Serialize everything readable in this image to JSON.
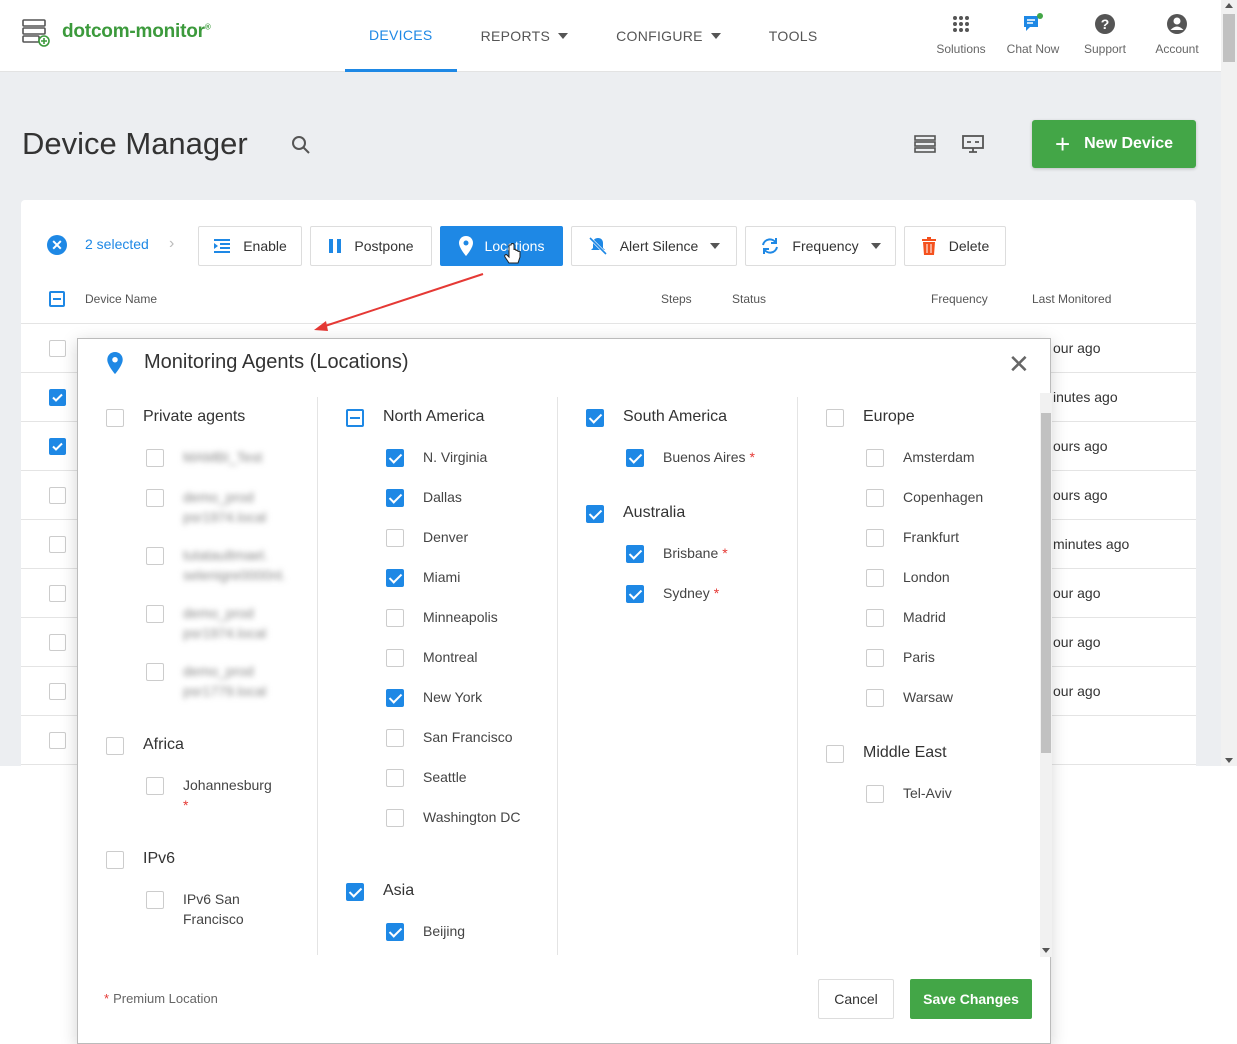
{
  "brand": {
    "name": "dotcom-monitor",
    "reg": "®"
  },
  "nav": {
    "items": [
      {
        "label": "DEVICES",
        "active": true
      },
      {
        "label": "REPORTS",
        "dropdown": true
      },
      {
        "label": "CONFIGURE",
        "dropdown": true
      },
      {
        "label": "TOOLS"
      }
    ]
  },
  "top_right": [
    {
      "label": "Solutions",
      "icon": "grid-icon"
    },
    {
      "label": "Chat Now",
      "icon": "chat-icon"
    },
    {
      "label": "Support",
      "icon": "help-icon"
    },
    {
      "label": "Account",
      "icon": "account-icon"
    }
  ],
  "page": {
    "title": "Device Manager",
    "new_device": "New Device"
  },
  "toolbar": {
    "selected": "2 selected",
    "enable": "Enable",
    "postpone": "Postpone",
    "locations": "Locations",
    "alert_silence": "Alert Silence",
    "frequency": "Frequency",
    "delete": "Delete"
  },
  "table": {
    "headers": {
      "name": "Device Name",
      "steps": "Steps",
      "status": "Status",
      "frequency": "Frequency",
      "last": "Last Monitored"
    },
    "rows": [
      {
        "checked": false,
        "last": "our ago"
      },
      {
        "checked": true,
        "last": "inutes ago"
      },
      {
        "checked": true,
        "last": "ours ago"
      },
      {
        "checked": false,
        "last": "ours ago"
      },
      {
        "checked": false,
        "last": "minutes ago"
      },
      {
        "checked": false,
        "last": "our ago"
      },
      {
        "checked": false,
        "last": "our ago"
      },
      {
        "checked": false,
        "last": "our ago"
      },
      {
        "checked": false,
        "last": ""
      }
    ]
  },
  "dialog": {
    "title": "Monitoring Agents (Locations)",
    "premium_note": "Premium Location",
    "cancel": "Cancel",
    "save": "Save Changes",
    "groups": {
      "private": {
        "label": "Private agents",
        "items": [
          "MAMBI_Test",
          "demo_prod psr1974.local",
          "tutatau8mael. selenigre0000nl.",
          "demo_prod psr1974.local",
          "demo_prod psr1779.local"
        ]
      },
      "africa": {
        "label": "Africa",
        "items": [
          "Johannesburg"
        ]
      },
      "ipv6": {
        "label": "IPv6",
        "items": [
          "IPv6 San Francisco"
        ]
      },
      "north_america": {
        "label": "North America",
        "items": [
          "N. Virginia",
          "Dallas",
          "Denver",
          "Miami",
          "Minneapolis",
          "Montreal",
          "New York",
          "San Francisco",
          "Seattle",
          "Washington DC"
        ]
      },
      "asia": {
        "label": "Asia",
        "items": [
          "Beijing"
        ]
      },
      "south_america": {
        "label": "South America",
        "items": [
          "Buenos Aires"
        ]
      },
      "australia": {
        "label": "Australia",
        "items": [
          "Brisbane",
          "Sydney"
        ]
      },
      "europe": {
        "label": "Europe",
        "items": [
          "Amsterdam",
          "Copenhagen",
          "Frankfurt",
          "London",
          "Madrid",
          "Paris",
          "Warsaw"
        ]
      },
      "middle_east": {
        "label": "Middle East",
        "items": [
          "Tel-Aviv"
        ]
      }
    }
  },
  "colors": {
    "accent": "#1e88e5",
    "brand_green": "#43a647",
    "premium_star": "#e53935",
    "annotation_arrow": "#e53935"
  }
}
